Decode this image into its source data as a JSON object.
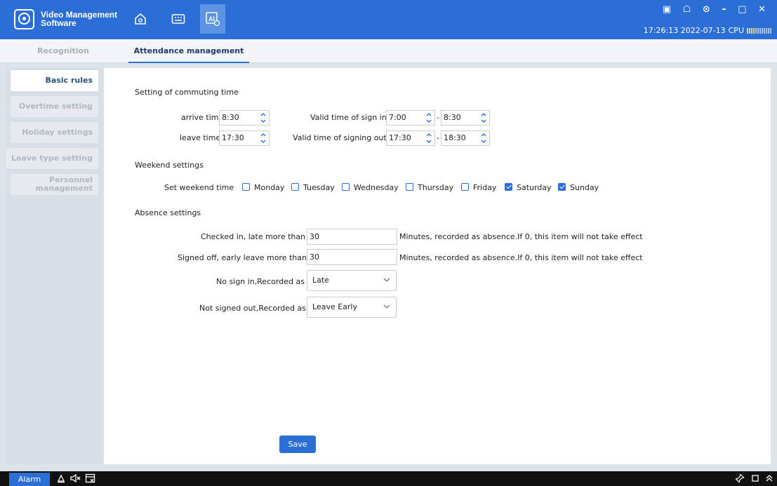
{
  "app": {
    "title_line1": "Video Management",
    "title_line2": "Software",
    "logo_label": "VMS",
    "nav_icons": [
      "home-icon",
      "keyboard-icon",
      "ai-icon"
    ],
    "window_controls": "▣ ☖ ⊙ – □ ✕",
    "datetime": "17:26:13 2022-07-13",
    "cpu_label": "CPU",
    "cpu_level": 0.35,
    "accent_color": "#2b6fd6"
  },
  "tabs": {
    "recognition": "Recognition",
    "attendance": "Attendance management"
  },
  "sidebar": {
    "basic_rules": "Basic rules",
    "overtime": "Overtime setting",
    "holiday": "Holiday settings",
    "leave_type": "Leave type setting",
    "personnel_1": "Personnel",
    "personnel_2": "management"
  },
  "commuting": {
    "heading": "Setting of commuting time",
    "arrive_label": "arrive time",
    "arrive_value": "8:30",
    "leave_label": "leave time",
    "leave_value": "17:30",
    "sign_in_label": "Valid time of sign in",
    "sign_in_from": "7:00",
    "sign_in_to": "8:30",
    "sign_out_label": "Valid time of signing out",
    "sign_out_from": "17:30",
    "sign_out_to": "18:30",
    "dash": "-"
  },
  "weekend": {
    "heading": "Weekend settings",
    "label": "Set weekend time",
    "days": [
      "Monday",
      "Tuesday",
      "Wednesday",
      "Thursday",
      "Friday",
      "Saturday",
      "Sunday"
    ],
    "checked": [
      false,
      false,
      false,
      false,
      false,
      true,
      true
    ]
  },
  "absence": {
    "heading": "Absence settings",
    "late_label": "Checked in, late more than",
    "late_value": "30",
    "late_note": "Minutes, recorded as absence.If 0, this item will not take effect",
    "early_label": "Signed off, early leave more than",
    "early_value": "30",
    "early_note": "Minutes, recorded as absence.If 0, this item will not take effect",
    "no_sign_in_label": "No sign in,Recorded as",
    "no_sign_in_value": "Late",
    "not_signed_out_label": "Not signed out,Recorded as",
    "not_signed_out_value": "Leave Early"
  },
  "save_label": "Save",
  "statusbar": {
    "alarm_label": "Alarm",
    "icons": [
      "alarm-clear-icon",
      "mute-icon",
      "screen-icon",
      "pin-icon",
      "window-icon",
      "collapse-icon"
    ]
  }
}
